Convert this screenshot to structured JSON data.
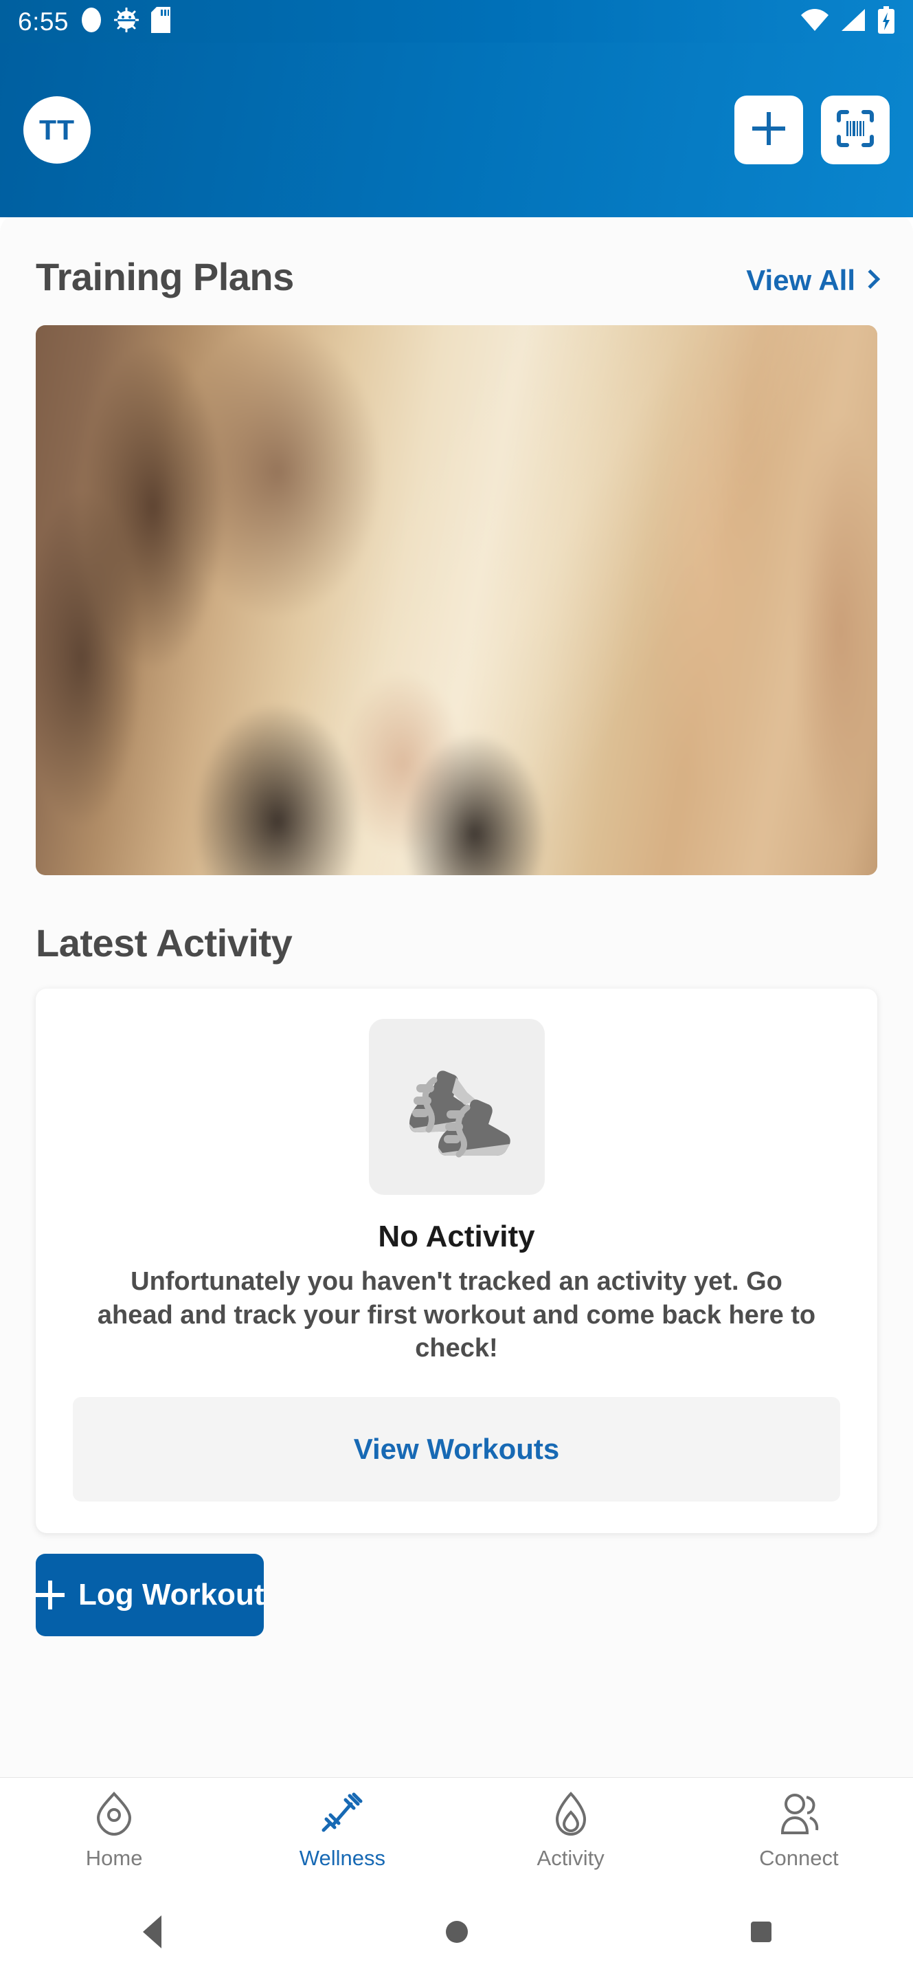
{
  "status_bar": {
    "time": "6:55",
    "left_icons": [
      "oval-indicator-icon",
      "android-debug-bug-icon",
      "sd-card-icon"
    ],
    "right_icons": [
      "wifi-icon",
      "cellular-signal-icon",
      "battery-charging-icon"
    ]
  },
  "app_bar": {
    "avatar_initials": "TT",
    "add_button_label": "add-icon",
    "scan_button_label": "barcode-scan-icon"
  },
  "training_plans": {
    "title": "Training Plans",
    "view_all_label": "View All",
    "hero_alt": "gym-dumbbell-training-photo"
  },
  "latest_activity": {
    "title": "Latest Activity",
    "empty_state": {
      "illustration": "running-shoes-icon",
      "title": "No Activity",
      "body": "Unfortunately you haven't tracked an activity yet. Go ahead and track your first workout and come back here to check!",
      "action_label": "View Workouts"
    }
  },
  "cta": {
    "label": "Log Workout"
  },
  "bottom_nav": {
    "items": [
      {
        "label": "Home",
        "icon": "location-pin-icon",
        "active": false
      },
      {
        "label": "Wellness",
        "icon": "dumbbell-icon",
        "active": true
      },
      {
        "label": "Activity",
        "icon": "flame-icon",
        "active": false
      },
      {
        "label": "Connect",
        "icon": "people-icon",
        "active": false
      }
    ]
  },
  "system_nav": {
    "back": "back-triangle-icon",
    "home": "home-circle-icon",
    "recents": "recents-square-icon"
  },
  "colors": {
    "brand_blue_dark": "#005fa0",
    "brand_blue_light": "#0a85ce",
    "accent_link": "#1769b4",
    "cta_blue": "#0560a9",
    "text_dark": "#1b1b1b",
    "text_muted": "#7d7d7d"
  }
}
